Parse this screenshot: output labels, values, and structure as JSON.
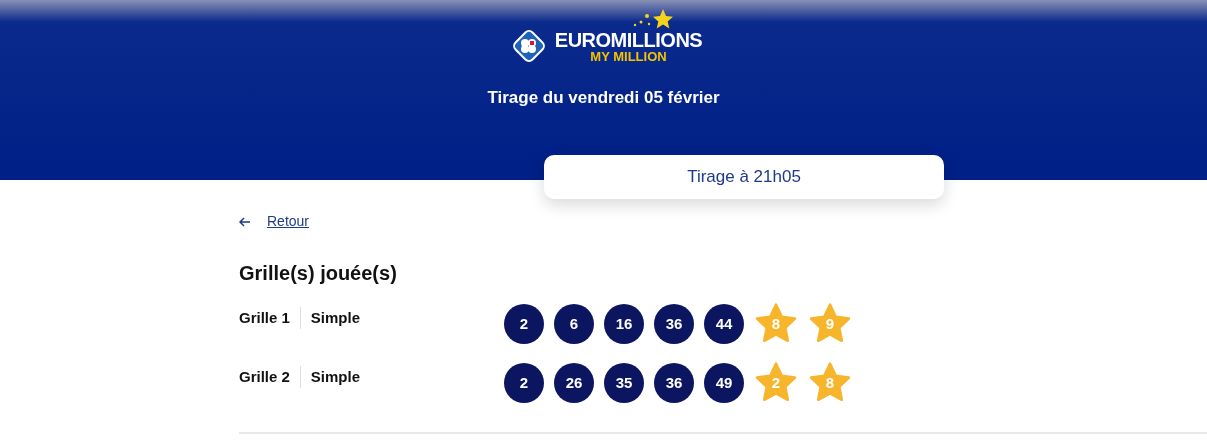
{
  "header": {
    "logo": {
      "brand": "EUROMILLIONS",
      "sub": "MY MILLION"
    },
    "title": "Tirage du vendredi 05 février",
    "draw_time": "Tirage à 21h05"
  },
  "back_link": {
    "label": "Retour"
  },
  "section_title": "Grille(s) jouée(s)",
  "grids": [
    {
      "name": "Grille 1",
      "type": "Simple",
      "numbers": [
        {
          "kind": "ball",
          "value": "2"
        },
        {
          "kind": "ball",
          "value": "6"
        },
        {
          "kind": "ball",
          "value": "16"
        },
        {
          "kind": "ball",
          "value": "36"
        },
        {
          "kind": "ball",
          "value": "44"
        },
        {
          "kind": "star",
          "value": "8"
        },
        {
          "kind": "star",
          "value": "9"
        }
      ]
    },
    {
      "name": "Grille 2",
      "type": "Simple",
      "numbers": [
        {
          "kind": "ball",
          "value": "2"
        },
        {
          "kind": "ball",
          "value": "26"
        },
        {
          "kind": "ball",
          "value": "35"
        },
        {
          "kind": "ball",
          "value": "36"
        },
        {
          "kind": "ball",
          "value": "49"
        },
        {
          "kind": "star",
          "value": "2"
        },
        {
          "kind": "star",
          "value": "8"
        }
      ]
    }
  ]
}
